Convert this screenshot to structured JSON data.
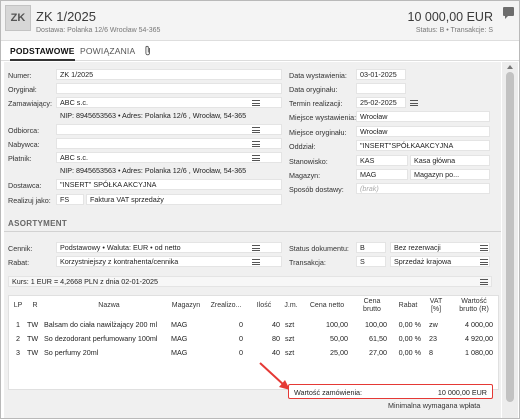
{
  "header": {
    "tag": "ZK",
    "title": "ZK 1/2025",
    "subtitle": "Dostawa: Polanka  12/6  Wrocław 54-365",
    "amount": "10 000,00 EUR",
    "status": "Status: B  •  Transakcje: S"
  },
  "tabs": [
    {
      "label": "PODSTAWOWE",
      "active": true
    },
    {
      "label": "POWIĄZANIA",
      "active": false
    }
  ],
  "form": {
    "numer": {
      "label": "Numer:",
      "value": "ZK 1/2025"
    },
    "oryginal": {
      "label": "Oryginał:",
      "value": ""
    },
    "zamawiajacy": {
      "label": "Zamawiający:",
      "value": "ABC s.c.",
      "detail": "NIP: 8945653563  •  Adres: Polanka  12/6 , Wrocław, 54-365"
    },
    "odbiorca": {
      "label": "Odbiorca:",
      "value": ""
    },
    "nabywca": {
      "label": "Nabywca:",
      "value": ""
    },
    "platnik": {
      "label": "Płatnik:",
      "value": "ABC s.c.",
      "detail": "NIP: 8945653563  •  Adres: Polanka  12/6 , Wrocław, 54-365"
    },
    "dostawca": {
      "label": "Dostawca:",
      "value": "\"INSERT\" SPÓŁKA AKCYJNA"
    },
    "realizuj": {
      "label": "Realizuj jako:",
      "code": "FS",
      "value": "Faktura VAT sprzedaży"
    },
    "data_wystawienia": {
      "label": "Data wystawienia:",
      "value": "03-01-2025"
    },
    "data_oryginalu": {
      "label": "Data oryginału:",
      "value": ""
    },
    "termin_realizacji": {
      "label": "Termin realizacji:",
      "value": "25-02-2025"
    },
    "miejsce_wystawienia": {
      "label": "Miejsce wystawienia:",
      "value": "Wrocław"
    },
    "miejsce_oryginalu": {
      "label": "Miejsce oryginału:",
      "value": "Wrocław"
    },
    "oddzial": {
      "label": "Oddział:",
      "value": "\"INSERT\"SPÓŁKAAKCYJNA"
    },
    "stanowisko": {
      "label": "Stanowisko:",
      "code": "KAS",
      "value": "Kasa główna"
    },
    "magazyn": {
      "label": "Magazyn:",
      "code": "MAG",
      "value": "Magazyn po..."
    },
    "sposob_dostawy": {
      "label": "Sposób dostawy:",
      "placeholder": "(brak)"
    }
  },
  "assortment": {
    "section_title": "ASORTYMENT",
    "cennik": {
      "label": "Cennik:",
      "value": "Podstawowy • Waluta: EUR • od netto"
    },
    "rabat": {
      "label": "Rabat:",
      "value": "Korzystniejszy z kontrahenta/cennika"
    },
    "status_dok": {
      "label": "Status dokumentu:",
      "code": "B",
      "value": "Bez rezerwacji"
    },
    "transakcja": {
      "label": "Transakcja:",
      "code": "S",
      "value": "Sprzedaż krajowa"
    },
    "kurs": "Kurs: 1 EUR = 4,2668 PLN z dnia 02-01-2025"
  },
  "table": {
    "columns": [
      "LP",
      "R",
      "Nazwa",
      "Magazyn",
      "Zrealizo...",
      "Ilość",
      "J.m.",
      "Cena netto",
      "Cena brutto",
      "Rabat",
      "VAT [%]",
      "Wartość brutto (R)"
    ],
    "rows": [
      [
        "1",
        "TW",
        "Balsam do ciała nawilżający 200 ml",
        "MAG",
        "0",
        "40",
        "szt",
        "100,00",
        "100,00",
        "0,00 %",
        "zw",
        "4 000,00"
      ],
      [
        "2",
        "TW",
        "So dezodorant perfumowany 100ml",
        "MAG",
        "0",
        "80",
        "szt",
        "50,00",
        "61,50",
        "0,00 %",
        "23",
        "4 920,00"
      ],
      [
        "3",
        "TW",
        "So perfumy 20ml",
        "MAG",
        "0",
        "40",
        "szt",
        "25,00",
        "27,00",
        "0,00 %",
        "8",
        "1 080,00"
      ]
    ]
  },
  "summary": {
    "label": "Wartość zamówienia:",
    "value": "10 000,00 EUR",
    "min_label": "Minimalna wymagana wpłata"
  }
}
